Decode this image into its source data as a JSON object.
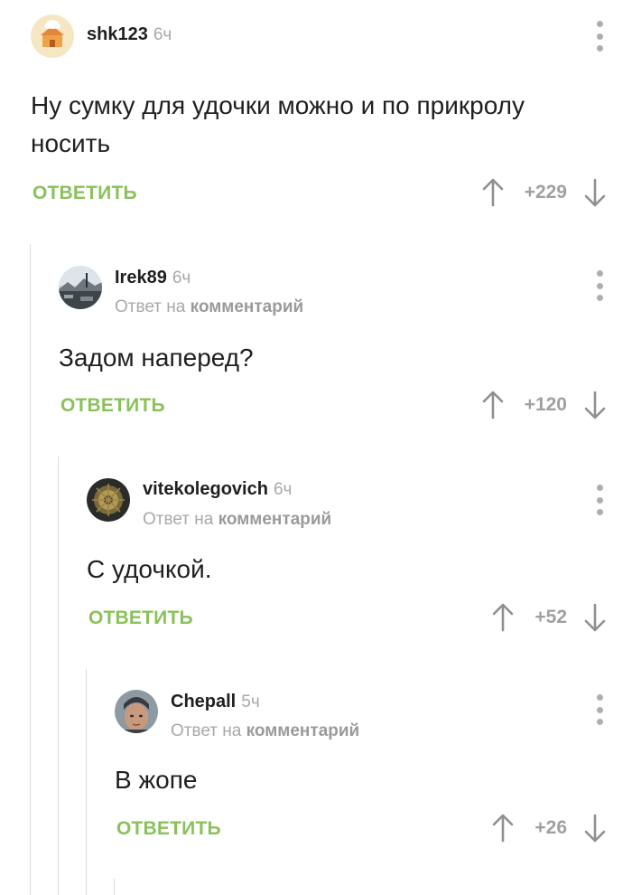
{
  "comments": [
    {
      "author": "shk123",
      "time": "6ч",
      "text": "Ну сумку для удочки можно и по прикролу носить",
      "reply_label": "ОТВЕТИТЬ",
      "score": "+229",
      "icon": "cake-house-avatar"
    },
    {
      "author": "Irek89",
      "time": "6ч",
      "reply_prefix": "Ответ на",
      "reply_target": "комментарий",
      "text": "Задом наперед?",
      "reply_label": "ОТВЕТИТЬ",
      "score": "+120",
      "icon": "landscape-avatar"
    },
    {
      "author": "vitekolegovich",
      "time": "6ч",
      "reply_prefix": "Ответ на",
      "reply_target": "комментарий",
      "text": "С удочкой.",
      "reply_label": "ОТВЕТИТЬ",
      "score": "+52",
      "icon": "golden-emblem-avatar"
    },
    {
      "author": "Chepall",
      "time": "5ч",
      "reply_prefix": "Ответ на",
      "reply_target": "комментарий",
      "text": "В жопе",
      "reply_label": "ОТВЕТИТЬ",
      "score": "+26",
      "icon": "person-beanie-avatar"
    }
  ],
  "colors": {
    "accent_green": "#8ac15a",
    "muted_gray": "#a8a8a8",
    "thread_line": "#dcdcdc"
  }
}
